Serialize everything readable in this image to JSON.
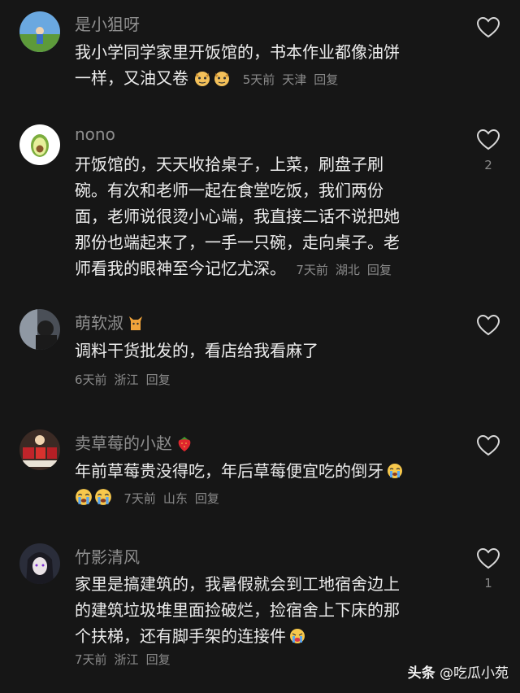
{
  "comments": [
    {
      "username": "是小狙呀",
      "text_lines": [
        "我小学同学家里开饭馆的，书本作业都像油饼",
        "一样，又油又卷"
      ],
      "emoji_icons": [
        "smirk-dog-emoji",
        "smirk-dog-emoji"
      ],
      "time": "5天前",
      "location": "天津",
      "reply_label": "回复",
      "like_count": ""
    },
    {
      "username": "nono",
      "text_lines": [
        "开饭馆的，天天收拾桌子，上菜，刷盘子刷",
        "碗。有次和老师一起在食堂吃饭，我们两份",
        "面，老师说很烫小心端，我直接二话不说把她",
        "那份也端起来了，一手一只碗，走向桌子。老",
        "师看我的眼神至今记忆尤深。"
      ],
      "time": "7天前",
      "location": "湖北",
      "reply_label": "回复",
      "like_count": "2"
    },
    {
      "username": "萌软淑",
      "username_emoji": "cat-emoji",
      "text_lines": [
        "调料干货批发的，看店给我看麻了"
      ],
      "time": "6天前",
      "location": "浙江",
      "reply_label": "回复",
      "like_count": ""
    },
    {
      "username": "卖草莓的小赵",
      "username_emoji": "strawberry-emoji",
      "text_lines": [
        "年前草莓贵没得吃，年后草莓便宜吃的倒牙"
      ],
      "emoji_icons": [
        "crying-emoji",
        "crying-emoji",
        "crying-emoji"
      ],
      "time": "7天前",
      "location": "山东",
      "reply_label": "回复",
      "like_count": ""
    },
    {
      "username": "竹影清风",
      "text_lines": [
        "家里是搞建筑的，我暑假就会到工地宿舍边上",
        "的建筑垃圾堆里面捡破烂，捡宿舍上下床的那",
        "个扶梯，还有脚手架的连接件"
      ],
      "emoji_icons": [
        "sobbing-emoji"
      ],
      "time": "7天前",
      "location": "浙江",
      "reply_label": "回复",
      "like_count": "1"
    }
  ],
  "watermark": {
    "brand": "头条",
    "author": "@吃瓜小苑"
  },
  "colors": {
    "background": "#161616",
    "text": "#ececec",
    "muted": "#8a8a8a"
  }
}
